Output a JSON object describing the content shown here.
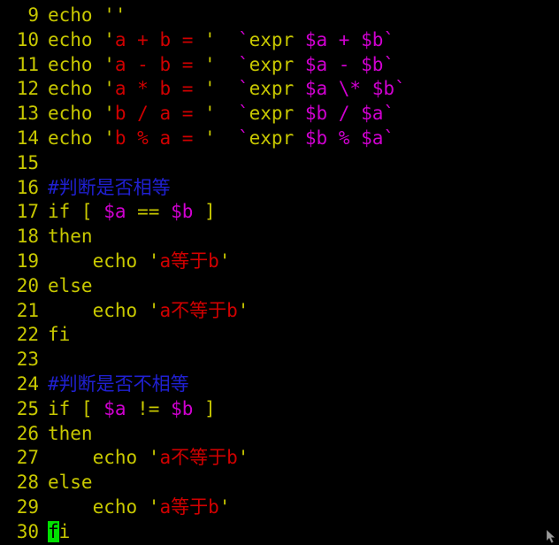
{
  "terminal": {
    "background": "#000000",
    "colors": {
      "normal": "#c8c800",
      "string": "#d00000",
      "variable": "#d000d0",
      "comment": "#2020d0",
      "cursor_bg": "#00e000",
      "cursor_fg": "#000000"
    },
    "first_line_number": 9,
    "last_line_number": 30,
    "cursor": {
      "line": 30,
      "column": 1,
      "char": "f"
    }
  },
  "lines": [
    {
      "number": "9",
      "text": "echo ''",
      "tokens": [
        {
          "text": "echo ''",
          "type": "normal"
        }
      ]
    },
    {
      "number": "10",
      "text": "echo 'a + b = '  `expr $a + $b`",
      "tokens": [
        {
          "text": "echo ",
          "type": "normal"
        },
        {
          "text": "'",
          "type": "quote"
        },
        {
          "text": "a + b = ",
          "type": "string"
        },
        {
          "text": "'",
          "type": "quote"
        },
        {
          "text": "  ",
          "type": "normal"
        },
        {
          "text": "`",
          "type": "backtick"
        },
        {
          "text": "expr ",
          "type": "normal"
        },
        {
          "text": "$a + $b",
          "type": "variable"
        },
        {
          "text": "`",
          "type": "backtick"
        }
      ]
    },
    {
      "number": "11",
      "text": "echo 'a - b = '  `expr $a - $b`",
      "tokens": [
        {
          "text": "echo ",
          "type": "normal"
        },
        {
          "text": "'",
          "type": "quote"
        },
        {
          "text": "a - b = ",
          "type": "string"
        },
        {
          "text": "'",
          "type": "quote"
        },
        {
          "text": "  ",
          "type": "normal"
        },
        {
          "text": "`",
          "type": "backtick"
        },
        {
          "text": "expr ",
          "type": "normal"
        },
        {
          "text": "$a - $b",
          "type": "variable"
        },
        {
          "text": "`",
          "type": "backtick"
        }
      ]
    },
    {
      "number": "12",
      "text": "echo 'a * b = '  `expr $a \\* $b`",
      "tokens": [
        {
          "text": "echo ",
          "type": "normal"
        },
        {
          "text": "'",
          "type": "quote"
        },
        {
          "text": "a * b = ",
          "type": "string"
        },
        {
          "text": "'",
          "type": "quote"
        },
        {
          "text": "  ",
          "type": "normal"
        },
        {
          "text": "`",
          "type": "backtick"
        },
        {
          "text": "expr ",
          "type": "normal"
        },
        {
          "text": "$a \\* $b",
          "type": "variable"
        },
        {
          "text": "`",
          "type": "backtick"
        }
      ]
    },
    {
      "number": "13",
      "text": "echo 'b / a = '  `expr $b / $a`",
      "tokens": [
        {
          "text": "echo ",
          "type": "normal"
        },
        {
          "text": "'",
          "type": "quote"
        },
        {
          "text": "b / a = ",
          "type": "string"
        },
        {
          "text": "'",
          "type": "quote"
        },
        {
          "text": "  ",
          "type": "normal"
        },
        {
          "text": "`",
          "type": "backtick"
        },
        {
          "text": "expr ",
          "type": "normal"
        },
        {
          "text": "$b / $a",
          "type": "variable"
        },
        {
          "text": "`",
          "type": "backtick"
        }
      ]
    },
    {
      "number": "14",
      "text": "echo 'b % a = '  `expr $b % $a`",
      "tokens": [
        {
          "text": "echo ",
          "type": "normal"
        },
        {
          "text": "'",
          "type": "quote"
        },
        {
          "text": "b % a = ",
          "type": "string"
        },
        {
          "text": "'",
          "type": "quote"
        },
        {
          "text": "  ",
          "type": "normal"
        },
        {
          "text": "`",
          "type": "backtick"
        },
        {
          "text": "expr ",
          "type": "normal"
        },
        {
          "text": "$b % $a",
          "type": "variable"
        },
        {
          "text": "`",
          "type": "backtick"
        }
      ]
    },
    {
      "number": "15",
      "text": "",
      "tokens": []
    },
    {
      "number": "16",
      "text": "#判断是否相等",
      "tokens": [
        {
          "text": "#",
          "type": "comment"
        },
        {
          "text": "判断是否相等",
          "type": "comment",
          "cjk": true
        }
      ]
    },
    {
      "number": "17",
      "text": "if [ $a == $b ]",
      "tokens": [
        {
          "text": "if [ ",
          "type": "normal"
        },
        {
          "text": "$a",
          "type": "variable"
        },
        {
          "text": " == ",
          "type": "normal"
        },
        {
          "text": "$b",
          "type": "variable"
        },
        {
          "text": " ]",
          "type": "normal"
        }
      ]
    },
    {
      "number": "18",
      "text": "then",
      "tokens": [
        {
          "text": "then",
          "type": "normal"
        }
      ]
    },
    {
      "number": "19",
      "text": "    echo 'a等于b'",
      "tokens": [
        {
          "text": "    echo ",
          "type": "normal"
        },
        {
          "text": "'",
          "type": "quote"
        },
        {
          "text": "a",
          "type": "string"
        },
        {
          "text": "等于",
          "type": "string",
          "cjk": true
        },
        {
          "text": "b",
          "type": "string"
        },
        {
          "text": "'",
          "type": "quote"
        }
      ]
    },
    {
      "number": "20",
      "text": "else",
      "tokens": [
        {
          "text": "else",
          "type": "normal"
        }
      ]
    },
    {
      "number": "21",
      "text": "    echo 'a不等于b'",
      "tokens": [
        {
          "text": "    echo ",
          "type": "normal"
        },
        {
          "text": "'",
          "type": "quote"
        },
        {
          "text": "a",
          "type": "string"
        },
        {
          "text": "不等于",
          "type": "string",
          "cjk": true
        },
        {
          "text": "b",
          "type": "string"
        },
        {
          "text": "'",
          "type": "quote"
        }
      ]
    },
    {
      "number": "22",
      "text": "fi",
      "tokens": [
        {
          "text": "fi",
          "type": "normal"
        }
      ]
    },
    {
      "number": "23",
      "text": "",
      "tokens": []
    },
    {
      "number": "24",
      "text": "#判断是否不相等",
      "tokens": [
        {
          "text": "#",
          "type": "comment"
        },
        {
          "text": "判断是否不相等",
          "type": "comment",
          "cjk": true
        }
      ]
    },
    {
      "number": "25",
      "text": "if [ $a != $b ]",
      "tokens": [
        {
          "text": "if [ ",
          "type": "normal"
        },
        {
          "text": "$a",
          "type": "variable"
        },
        {
          "text": " != ",
          "type": "normal"
        },
        {
          "text": "$b",
          "type": "variable"
        },
        {
          "text": " ]",
          "type": "normal"
        }
      ]
    },
    {
      "number": "26",
      "text": "then",
      "tokens": [
        {
          "text": "then",
          "type": "normal"
        }
      ]
    },
    {
      "number": "27",
      "text": "    echo 'a不等于b'",
      "tokens": [
        {
          "text": "    echo ",
          "type": "normal"
        },
        {
          "text": "'",
          "type": "quote"
        },
        {
          "text": "a",
          "type": "string"
        },
        {
          "text": "不等于",
          "type": "string",
          "cjk": true
        },
        {
          "text": "b",
          "type": "string"
        },
        {
          "text": "'",
          "type": "quote"
        }
      ]
    },
    {
      "number": "28",
      "text": "else",
      "tokens": [
        {
          "text": "else",
          "type": "normal"
        }
      ]
    },
    {
      "number": "29",
      "text": "    echo 'a等于b'",
      "tokens": [
        {
          "text": "    echo ",
          "type": "normal"
        },
        {
          "text": "'",
          "type": "quote"
        },
        {
          "text": "a",
          "type": "string"
        },
        {
          "text": "等于",
          "type": "string",
          "cjk": true
        },
        {
          "text": "b",
          "type": "string"
        },
        {
          "text": "'",
          "type": "quote"
        }
      ]
    },
    {
      "number": "30",
      "text": "fi",
      "tokens": [
        {
          "text": "f",
          "type": "normal",
          "cursor": true
        },
        {
          "text": "i",
          "type": "normal"
        }
      ]
    }
  ]
}
